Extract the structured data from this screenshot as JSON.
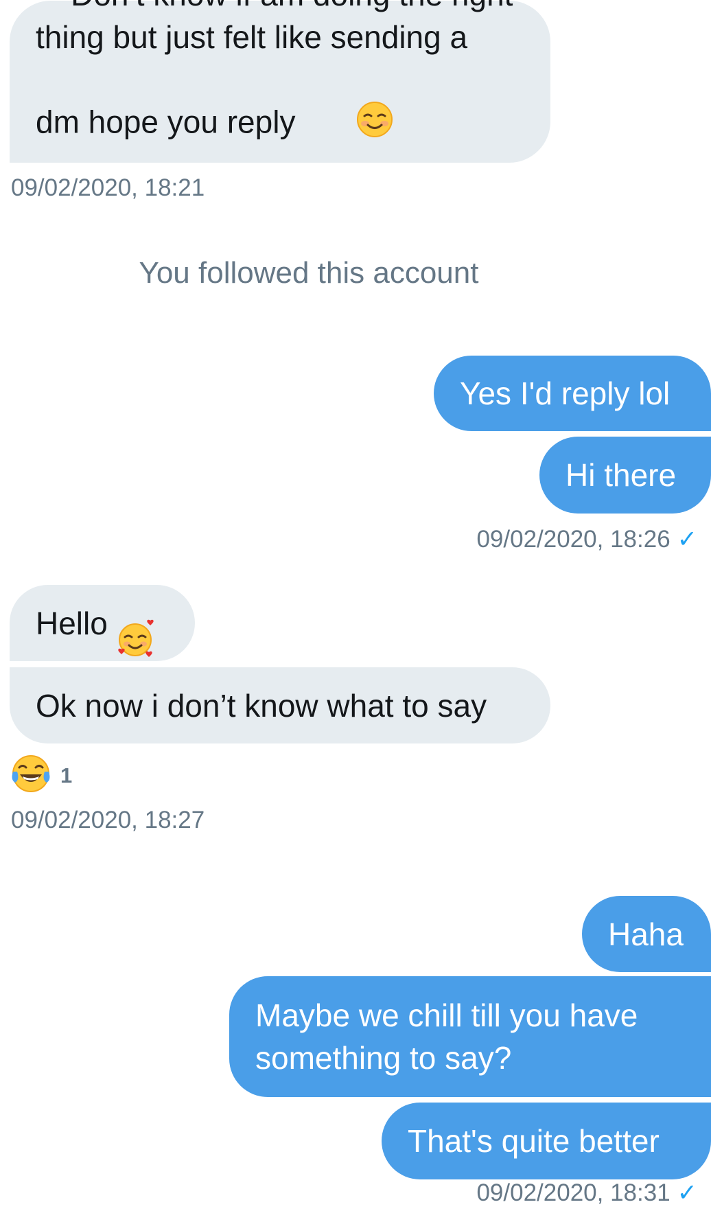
{
  "messages": {
    "m1": {
      "text": "Don’t know if am doing the right\nthing but just felt like sending a\ndm hope you reply",
      "emoji": "smiling-blush-emoji"
    },
    "ts1": "09/02/2020, 18:21",
    "system": "You followed this account",
    "m2": "Yes I'd reply lol",
    "m3": "Hi there",
    "ts2": "09/02/2020, 18:26",
    "m4": {
      "text": "Hello",
      "emoji": "smiling-face-with-hearts-emoji"
    },
    "m5": "Ok now i don’t know what to say",
    "reaction": {
      "emoji": "tears-of-joy-emoji",
      "count": "1"
    },
    "ts3": "09/02/2020, 18:27",
    "m6": "Haha",
    "m7": "Maybe we chill till you have\nsomething to say?",
    "m8": "That's quite better",
    "ts4": "09/02/2020, 18:31",
    "read_check": "✓"
  },
  "colors": {
    "incoming_bubble": "#e6ecf0",
    "outgoing_bubble": "#4a9ee8",
    "timestamp": "#657786",
    "read_check": "#1da1f2"
  }
}
